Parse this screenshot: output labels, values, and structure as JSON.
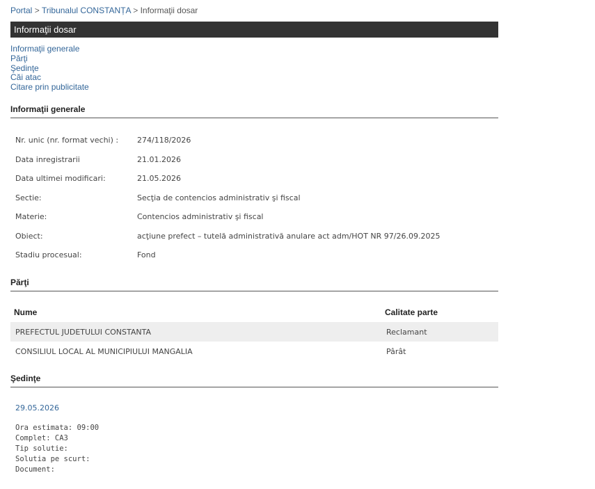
{
  "breadcrumb": {
    "items": [
      "Portal",
      "Tribunalul CONSTANȚA",
      "Informaţii dosar"
    ],
    "separator": ">"
  },
  "title_bar": "Informaţii dosar",
  "toc": [
    "Informaţii generale",
    "Părţi",
    "Şedinţe",
    "Căi atac",
    "Citare prin publicitate"
  ],
  "general": {
    "header": "Informaţii generale",
    "rows": [
      {
        "label": "Nr. unic (nr. format vechi) :",
        "value": "274/118/2026"
      },
      {
        "label": "Data inregistrarii",
        "value": "21.01.2026"
      },
      {
        "label": "Data ultimei modificari:",
        "value": "21.05.2026"
      },
      {
        "label": "Sectie:",
        "value": "Secţia de contencios administrativ şi fiscal"
      },
      {
        "label": "Materie:",
        "value": "Contencios administrativ şi fiscal"
      },
      {
        "label": "Obiect:",
        "value": "acţiune prefect – tutelă administrativă anulare act adm/HOT NR 97/26.09.2025"
      },
      {
        "label": "Stadiu procesual:",
        "value": "Fond"
      }
    ]
  },
  "parti": {
    "header": "Părţi",
    "columns": [
      "Nume",
      "Calitate parte"
    ],
    "rows": [
      {
        "nume": "PREFECTUL JUDETULUI CONSTANTA",
        "calitate": "Reclamant"
      },
      {
        "nume": "CONSILIUL LOCAL AL MUNICIPIULUI MANGALIA",
        "calitate": "Pârât"
      }
    ]
  },
  "sedinte": {
    "header": "Şedinţe",
    "date": "29.05.2026",
    "details": [
      "Ora estimata: 09:00",
      "Complet: CA3",
      "Tip solutie:",
      "Solutia pe scurt:",
      "Document:"
    ]
  },
  "colors": {
    "link": "#336699",
    "title_bar_bg": "#333333",
    "row_alt_bg": "#eeeeee"
  }
}
